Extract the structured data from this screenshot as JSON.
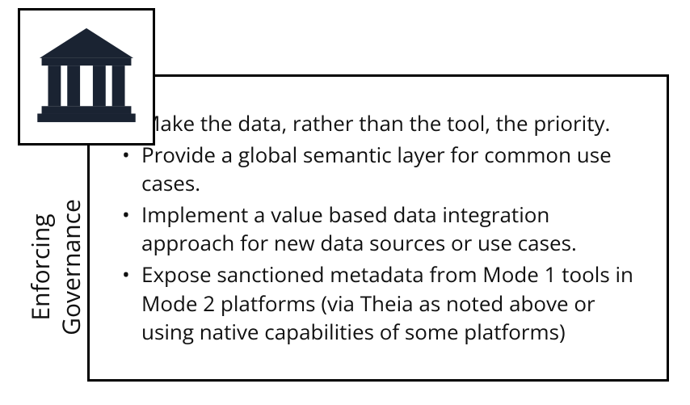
{
  "icon_color": "#1a2332",
  "side_label": {
    "line1": "Enforcing",
    "line2": "Governance"
  },
  "bullets": [
    "Make the data, rather than the tool, the priority.",
    "Provide a global semantic layer for common use cases.",
    "Implement a value based data integration approach for new data sources or use cases.",
    "Expose sanctioned metadata from Mode 1 tools in Mode 2 platforms (via Theia as noted above or using native capabilities of some platforms)"
  ]
}
